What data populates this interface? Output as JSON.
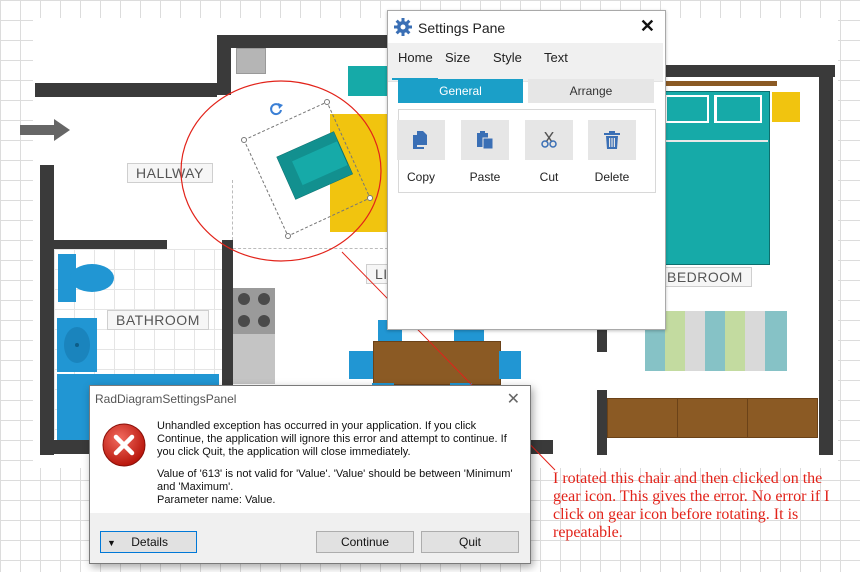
{
  "floorplan": {
    "labels": {
      "hallway": "HALLWAY",
      "bathroom": "BATHROOM",
      "bedroom": "BEDROOM",
      "living_partial": "LI"
    },
    "colors": {
      "wall": "#3a3a3a",
      "teal": "#16aaa8",
      "yellow": "#f1c40f",
      "blue": "#2196d3",
      "brown": "#8b5a24",
      "annotation": "#e2231a"
    },
    "icons": [
      "arrow-right-icon",
      "rotate-icon"
    ]
  },
  "settings_pane": {
    "title": "Settings Pane",
    "icon": "gear-icon",
    "close_glyph": "✕",
    "tabs": [
      "Home",
      "Size",
      "Style",
      "Text"
    ],
    "active_tab": "Home",
    "subtabs": [
      "General",
      "Arrange"
    ],
    "active_subtab": "General",
    "accent_color": "#1b9fc8",
    "actions": [
      {
        "label": "Copy",
        "icon": "copy-icon"
      },
      {
        "label": "Paste",
        "icon": "paste-icon"
      },
      {
        "label": "Cut",
        "icon": "cut-icon"
      },
      {
        "label": "Delete",
        "icon": "delete-icon"
      }
    ]
  },
  "error_dialog": {
    "title": "RadDiagramSettingsPanel",
    "close_glyph": "✕",
    "icon": "error-icon",
    "message_1": "Unhandled exception has occurred in your application. If you click Continue, the application will ignore this error and attempt to continue. If you click Quit, the application will close immediately.",
    "message_2": "Value of '613' is not valid for 'Value'. 'Value' should be between 'Minimum' and 'Maximum'.",
    "message_3": "Parameter name: Value.",
    "details_label": "Details",
    "continue_label": "Continue",
    "quit_label": "Quit"
  },
  "annotation": {
    "text": "I rotated this chair and then clicked on the gear icon.  This gives the error.  No error if I click on gear icon before rotating.  It is repeatable."
  }
}
